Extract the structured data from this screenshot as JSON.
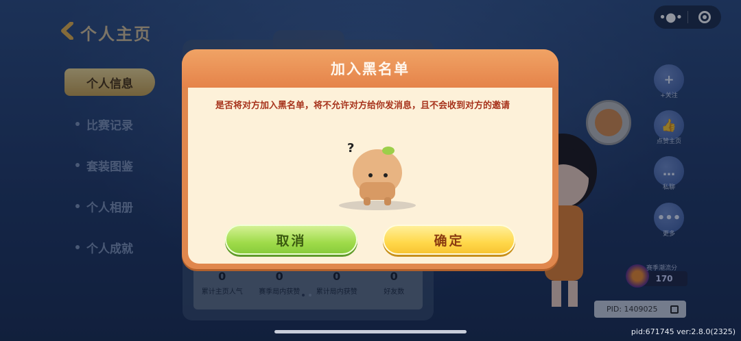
{
  "header": {
    "title": "个人主页"
  },
  "nav": {
    "active": "个人信息",
    "items": [
      "比赛记录",
      "套装图鉴",
      "个人相册",
      "个人成就"
    ]
  },
  "stats": [
    {
      "value": "0",
      "label": "累计主页人气"
    },
    {
      "value": "0",
      "label": "赛季局内获赞"
    },
    {
      "value": "0",
      "label": "累计局内获赞"
    },
    {
      "value": "0",
      "label": "好友数"
    }
  ],
  "right_actions": [
    {
      "label": "+关注",
      "icon": "follow-icon"
    },
    {
      "label": "点赞主页",
      "icon": "thumbs-up-icon"
    },
    {
      "label": "私聊",
      "icon": "chat-icon"
    },
    {
      "label": "更多",
      "icon": "more-icon"
    }
  ],
  "season": {
    "label": "赛季潮流分",
    "value": "170"
  },
  "pid": "PID: 1409025",
  "version": "pid:671745 ver:2.8.0(2325)",
  "modal": {
    "title": "加入黑名单",
    "message": "是否将对方加入黑名单，将不允许对方给你发消息，且不会收到对方的邀请",
    "cancel": "取消",
    "confirm": "确定"
  },
  "colors": {
    "modal_header": "#e5834a",
    "modal_body": "#fdf1d9",
    "cancel_button": "#9fdb4a",
    "confirm_button": "#ffd84a",
    "message_text": "#a7331c"
  }
}
